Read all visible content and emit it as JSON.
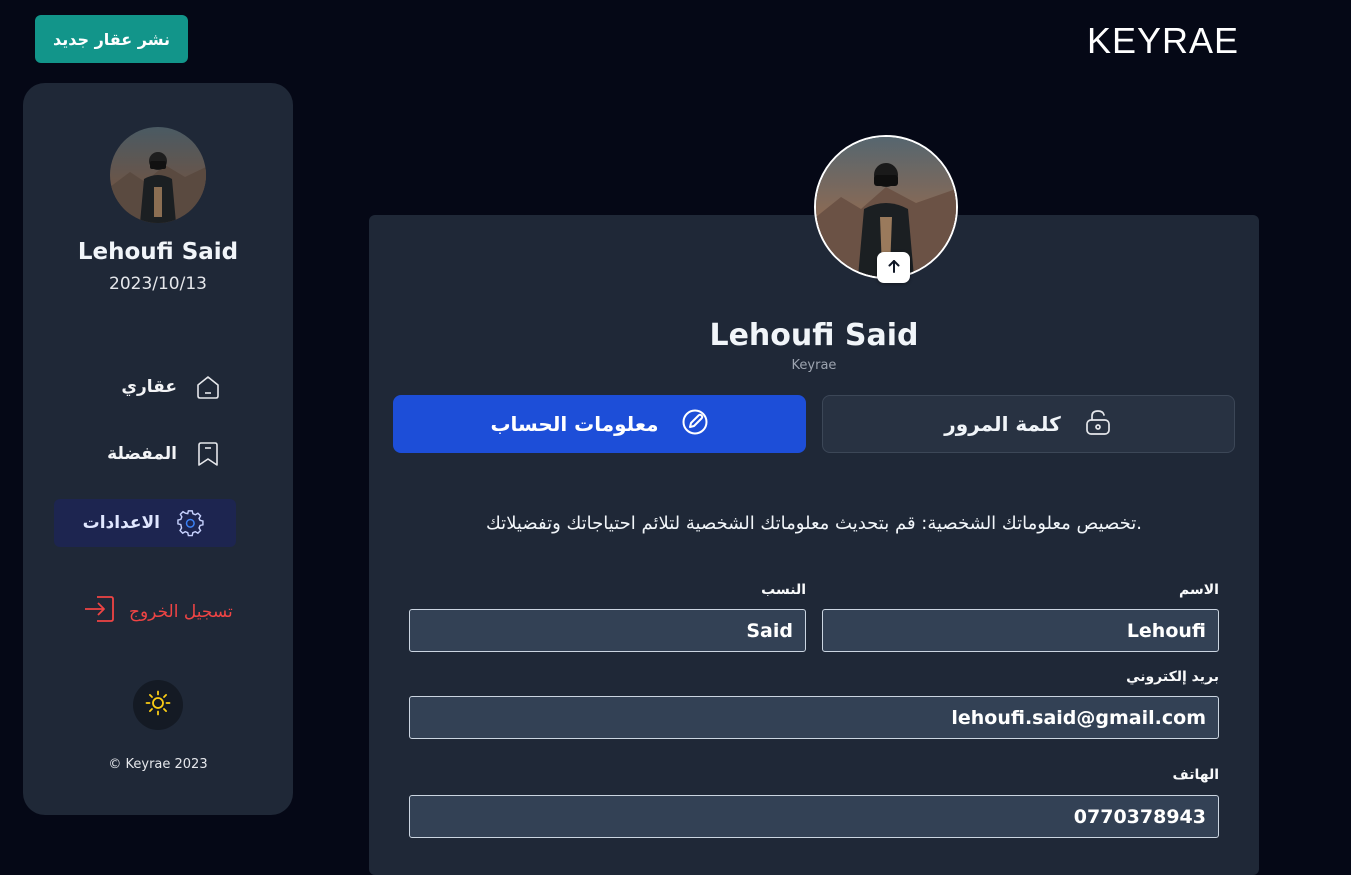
{
  "header": {
    "brand": "KEYRAE",
    "publish_button": "نشر عقار جديد"
  },
  "sidebar": {
    "user_name": "Lehoufi Said",
    "date": "2023/10/13",
    "nav": [
      {
        "label": "عقاري",
        "icon": "home-icon",
        "active": false
      },
      {
        "label": "المفضلة",
        "icon": "bookmark-icon",
        "active": false
      },
      {
        "label": "الاعدادات",
        "icon": "gear-icon",
        "active": true
      }
    ],
    "logout": "تسجيل الخروج",
    "theme_icon": "sun-icon",
    "copyright": "© Keyrae 2023"
  },
  "profile": {
    "name": "Lehoufi Said",
    "subtitle": "Keyrae",
    "tabs": {
      "account": "معلومات الحساب",
      "password": "كلمة المرور"
    },
    "intro": ".تخصيص معلوماتك الشخصية: قم بتحديث معلوماتك الشخصية لتلائم احتياجاتك وتفضيلاتك"
  },
  "form": {
    "first_name_label": "الاسم",
    "first_name_value": "Lehoufi",
    "last_name_label": "النسب",
    "last_name_value": "Said",
    "email_label": "بريد إلكتروني",
    "email_value": "lehoufi.said@gmail.com",
    "phone_label": "الهاتف",
    "phone_value": "0770378943"
  },
  "colors": {
    "background": "#050816",
    "panel": "#1f2837",
    "accent_blue": "#1d4ed8",
    "accent_teal": "#12958a",
    "danger": "#ef4444",
    "sun": "#facc15"
  }
}
